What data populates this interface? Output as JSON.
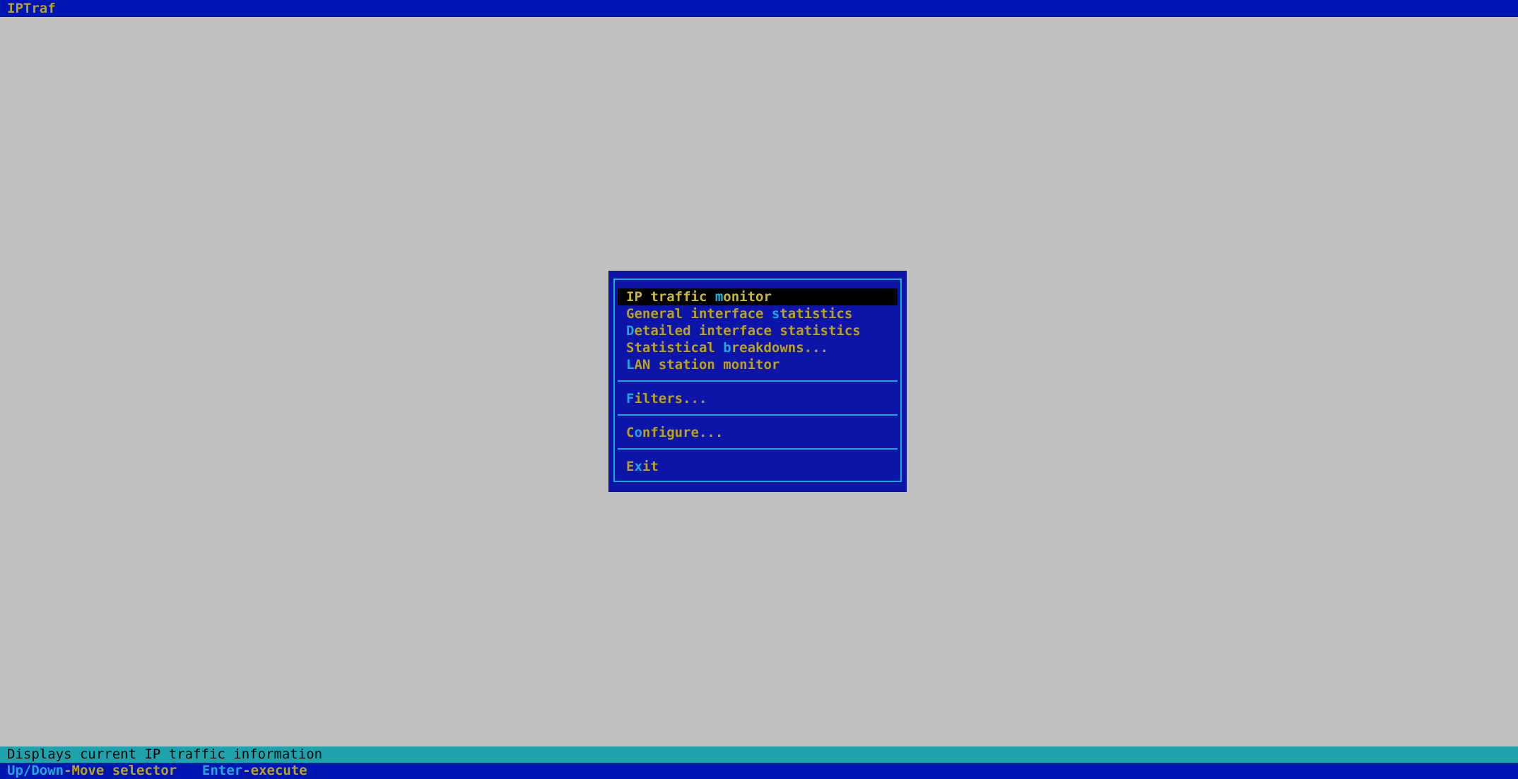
{
  "app": {
    "title": "IPTraf"
  },
  "menu": {
    "items": [
      {
        "pre": "IP traffic ",
        "hotkey": "m",
        "post": "onitor"
      },
      {
        "pre": "General interface ",
        "hotkey": "s",
        "post": "tatistics"
      },
      {
        "pre": "",
        "hotkey": "D",
        "post": "etailed interface statistics"
      },
      {
        "pre": "Statistical ",
        "hotkey": "b",
        "post": "reakdowns..."
      },
      {
        "pre": "",
        "hotkey": "L",
        "post": "AN station monitor"
      },
      {
        "pre": "",
        "hotkey": "F",
        "post": "ilters..."
      },
      {
        "pre": "C",
        "hotkey": "o",
        "post": "nfigure..."
      },
      {
        "pre": "E",
        "hotkey": "x",
        "post": "it"
      }
    ],
    "selected_index": 0
  },
  "status": {
    "text": "Displays current IP traffic information"
  },
  "help": {
    "key1": "Up/Down",
    "desc1": "-Move selector",
    "key2": "Enter",
    "desc2": "-execute"
  },
  "colors": {
    "background": "#c0c0c0",
    "bar_blue": "#0016b2",
    "menu_blue": "#0d14a8",
    "text_gold": "#b8a21e",
    "hotkey_cyan": "#22a8d8",
    "status_teal": "#1ea3ad"
  }
}
